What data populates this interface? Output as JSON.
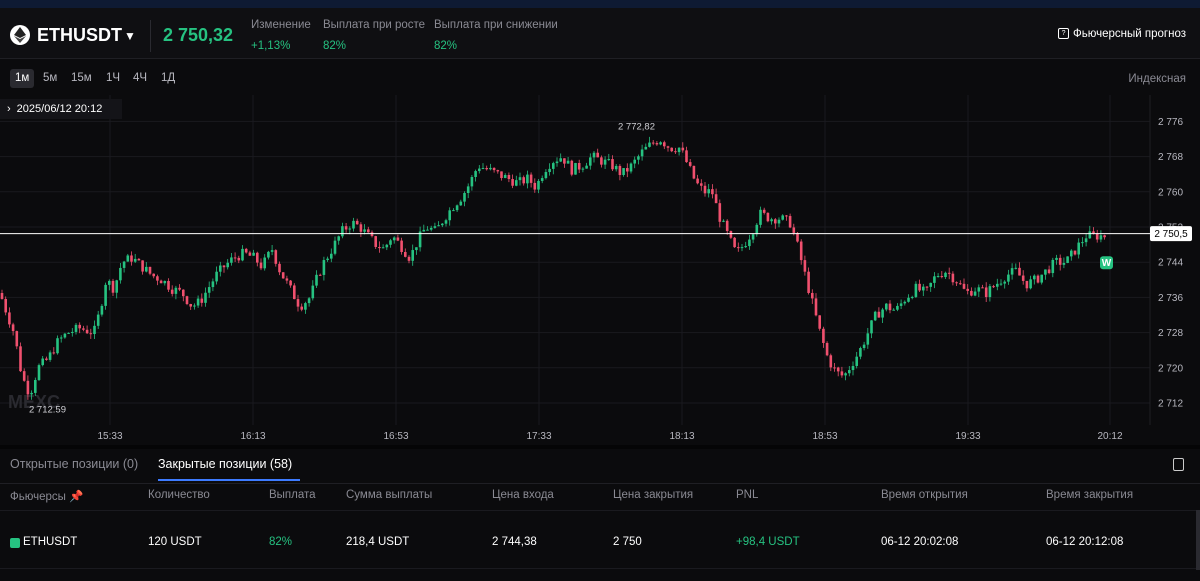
{
  "header": {
    "symbol": "ETHUSDT",
    "price": "2 750,32",
    "stats": [
      {
        "label": "Изменение",
        "value": "+1,13%"
      },
      {
        "label": "Выплата при росте",
        "value": "82%"
      },
      {
        "label": "Выплата при снижении",
        "value": "82%"
      }
    ],
    "forecast_label": "Фьючерсный прогноз"
  },
  "timeframes": [
    "1м",
    "5м",
    "15м",
    "1Ч",
    "4Ч",
    "1Д"
  ],
  "active_timeframe": "1м",
  "index_label": "Индексная",
  "chart_data": {
    "type": "candlestick",
    "cursor_datetime": "2025/06/12 20:12",
    "current_price_label": "2 750,5",
    "high_label": "2 772,82",
    "low_label": "2 712.59",
    "watermark": "MEXC",
    "marker": "W",
    "y_ticks": [
      "2 776",
      "2 768",
      "2 760",
      "2 752",
      "2 744",
      "2 736",
      "2 728",
      "2 720",
      "2 712"
    ],
    "x_ticks": [
      "15:33",
      "16:13",
      "16:53",
      "17:33",
      "18:13",
      "18:53",
      "19:33",
      "20:12"
    ],
    "ylim": [
      2707,
      2782
    ],
    "current_price": 2750.5,
    "colors": {
      "up": "#26c281",
      "down": "#f0506e"
    },
    "path": [
      [
        0,
        2737
      ],
      [
        6,
        2733
      ],
      [
        14,
        2728
      ],
      [
        22,
        2718
      ],
      [
        30,
        2714
      ],
      [
        38,
        2720
      ],
      [
        48,
        2722
      ],
      [
        58,
        2726
      ],
      [
        68,
        2728
      ],
      [
        80,
        2729
      ],
      [
        94,
        2728
      ],
      [
        100,
        2733
      ],
      [
        106,
        2740
      ],
      [
        114,
        2738
      ],
      [
        122,
        2744
      ],
      [
        132,
        2745
      ],
      [
        142,
        2743
      ],
      [
        152,
        2741
      ],
      [
        162,
        2740
      ],
      [
        172,
        2738
      ],
      [
        182,
        2737
      ],
      [
        192,
        2734
      ],
      [
        200,
        2735
      ],
      [
        208,
        2738
      ],
      [
        216,
        2741
      ],
      [
        224,
        2743
      ],
      [
        234,
        2745
      ],
      [
        244,
        2746
      ],
      [
        254,
        2745
      ],
      [
        262,
        2743
      ],
      [
        272,
        2747
      ],
      [
        280,
        2742
      ],
      [
        290,
        2738
      ],
      [
        300,
        2734
      ],
      [
        310,
        2736
      ],
      [
        318,
        2741
      ],
      [
        324,
        2744
      ],
      [
        332,
        2747
      ],
      [
        342,
        2751
      ],
      [
        352,
        2753
      ],
      [
        360,
        2752
      ],
      [
        368,
        2750
      ],
      [
        376,
        2748
      ],
      [
        384,
        2747
      ],
      [
        392,
        2750
      ],
      [
        400,
        2748
      ],
      [
        410,
        2745
      ],
      [
        418,
        2749
      ],
      [
        426,
        2752
      ],
      [
        436,
        2751
      ],
      [
        444,
        2754
      ],
      [
        454,
        2757
      ],
      [
        462,
        2759
      ],
      [
        470,
        2762
      ],
      [
        478,
        2766
      ],
      [
        488,
        2765
      ],
      [
        498,
        2764
      ],
      [
        508,
        2763
      ],
      [
        518,
        2762
      ],
      [
        528,
        2763
      ],
      [
        536,
        2761
      ],
      [
        544,
        2765
      ],
      [
        552,
        2767
      ],
      [
        562,
        2768
      ],
      [
        572,
        2765
      ],
      [
        582,
        2766
      ],
      [
        592,
        2768
      ],
      [
        602,
        2767
      ],
      [
        612,
        2766
      ],
      [
        622,
        2764
      ],
      [
        632,
        2766
      ],
      [
        642,
        2769
      ],
      [
        652,
        2771
      ],
      [
        660,
        2772
      ],
      [
        670,
        2770
      ],
      [
        680,
        2770
      ],
      [
        688,
        2766
      ],
      [
        696,
        2762
      ],
      [
        704,
        2760
      ],
      [
        712,
        2760
      ],
      [
        720,
        2754
      ],
      [
        728,
        2750
      ],
      [
        736,
        2746
      ],
      [
        744,
        2748
      ],
      [
        752,
        2751
      ],
      [
        760,
        2755
      ],
      [
        770,
        2754
      ],
      [
        780,
        2754
      ],
      [
        790,
        2753
      ],
      [
        796,
        2749
      ],
      [
        804,
        2742
      ],
      [
        812,
        2735
      ],
      [
        820,
        2728
      ],
      [
        828,
        2722
      ],
      [
        836,
        2719
      ],
      [
        844,
        2718
      ],
      [
        852,
        2721
      ],
      [
        860,
        2724
      ],
      [
        868,
        2728
      ],
      [
        876,
        2732
      ],
      [
        886,
        2734
      ],
      [
        896,
        2733
      ],
      [
        906,
        2736
      ],
      [
        916,
        2738
      ],
      [
        926,
        2737
      ],
      [
        936,
        2741
      ],
      [
        946,
        2742
      ],
      [
        956,
        2740
      ],
      [
        966,
        2737
      ],
      [
        976,
        2738
      ],
      [
        986,
        2737
      ],
      [
        996,
        2739
      ],
      [
        1006,
        2741
      ],
      [
        1016,
        2742
      ],
      [
        1026,
        2739
      ],
      [
        1036,
        2740
      ],
      [
        1046,
        2742
      ],
      [
        1056,
        2744
      ],
      [
        1066,
        2744
      ],
      [
        1076,
        2747
      ],
      [
        1086,
        2750
      ],
      [
        1096,
        2750
      ],
      [
        1106,
        2750
      ]
    ]
  },
  "tabs": [
    {
      "label": "Открытые позиции (0)"
    },
    {
      "label": "Закрытые позиции (58)"
    }
  ],
  "table": {
    "columns": [
      "Фьючерсы",
      "Количество",
      "Выплата",
      "Сумма выплаты",
      "Цена входа",
      "Цена закрытия",
      "PNL",
      "Время открытия",
      "Время закрытия"
    ],
    "rows": [
      {
        "symbol": "ETHUSDT",
        "qty": "120 USDT",
        "payout": "82%",
        "payout_sum": "218,4 USDT",
        "entry": "2 744,38",
        "close": "2 750",
        "pnl": "+98,4 USDT",
        "open_time": "06-12 20:02:08",
        "close_time": "06-12 20:12:08"
      }
    ]
  }
}
